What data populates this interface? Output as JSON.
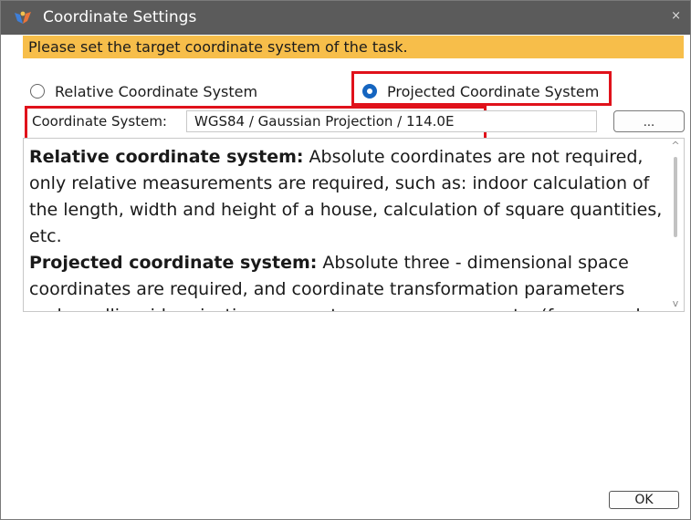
{
  "window": {
    "title": "Coordinate Settings",
    "close_glyph": "×"
  },
  "banner": {
    "text": "Please set the target coordinate system of the task."
  },
  "options": {
    "relative": {
      "label": "Relative Coordinate System",
      "selected": false
    },
    "projected": {
      "label": "Projected Coordinate System",
      "selected": true
    }
  },
  "coordinate_system": {
    "label": "Coordinate System:",
    "value": "WGS84 / Gaussian Projection / 114.0E",
    "browse_label": "..."
  },
  "description": {
    "relative_heading": "Relative coordinate system:",
    "relative_body": " Absolute coordinates are not required, only relative measurements are required, such as: indoor calculation of the length, width and height of a house, calculation of square quantities, etc.",
    "projected_heading": "Projected coordinate system:",
    "projected_body": " Absolute three - dimensional space coordinates are required, and coordinate transformation parameters and an ellipsoid projection parameters are necessary, etc. (for example"
  },
  "scroll": {
    "up_glyph": "^",
    "down_glyph": "v"
  },
  "footer": {
    "ok_label": "OK"
  },
  "colors": {
    "banner": "#f7be4a",
    "highlight": "#e0121b",
    "radio_selected": "#1565c0",
    "titlebar": "#5b5b5b"
  },
  "icons": {
    "app": "app-logo-icon",
    "close": "close-icon"
  }
}
